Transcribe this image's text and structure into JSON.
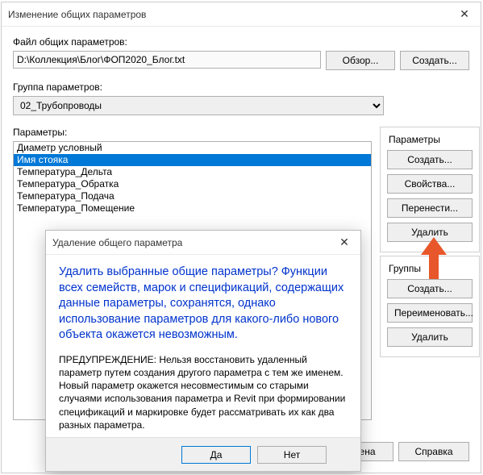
{
  "window": {
    "title": "Изменение общих параметров"
  },
  "file": {
    "label": "Файл общих параметров:",
    "path": "D:\\Коллекция\\Блог\\ФОП2020_Блог.txt",
    "browse": "Обзор...",
    "create": "Создать..."
  },
  "group": {
    "label": "Группа параметров:",
    "selected": "02_Трубопроводы"
  },
  "params": {
    "label": "Параметры:",
    "items": [
      "Диаметр условный",
      "Имя стояка",
      "Температура_Дельта",
      "Температура_Обратка",
      "Температура_Подача",
      "Температура_Помещение"
    ],
    "selected_index": 1
  },
  "right": {
    "params_legend": "Параметры",
    "new": "Создать...",
    "props": "Свойства...",
    "move": "Перенести...",
    "delete": "Удалить",
    "groups_legend": "Группы",
    "g_new": "Создать...",
    "g_rename": "Переименовать...",
    "g_delete": "Удалить"
  },
  "bottom": {
    "cancel": "Отмена",
    "help": "Справка"
  },
  "modal": {
    "title": "Удаление общего параметра",
    "blue": "Удалить выбранные общие параметры? Функции всех семейств, марок и спецификаций, содержащих данные параметры, сохранятся, однако использование параметров для какого-либо нового объекта окажется невозможным.",
    "black": "ПРЕДУПРЕЖДЕНИЕ: Нельзя восстановить удаленный параметр путем создания другого параметра с тем же именем.  Новый параметр окажется несовместимым со старыми случаями использования параметра и Revit при формировании спецификаций и маркировке будет рассматривать их как два разных параметра.",
    "yes": "Да",
    "no": "Нет"
  }
}
